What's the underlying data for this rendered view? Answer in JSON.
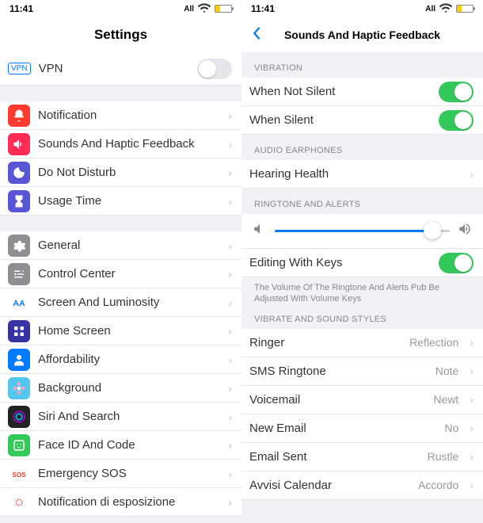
{
  "statusBar": {
    "time": "11:41",
    "carrier": "All"
  },
  "left": {
    "title": "Settings",
    "vpnLabel": "VPN",
    "vpnText": "VPN",
    "rows1": [
      {
        "label": "Notification",
        "icon": "#ff3b30",
        "svg": "bell"
      },
      {
        "label": "Sounds And Haptic Feedback",
        "icon": "#ff2d55",
        "svg": "speaker"
      },
      {
        "label": "Do Not Disturb",
        "icon": "#5856d6",
        "svg": "moon"
      },
      {
        "label": "Usage Time",
        "icon": "#5856d6",
        "svg": "hourglass"
      }
    ],
    "rows2": [
      {
        "label": "General",
        "icon": "#8e8e93",
        "svg": "gear"
      },
      {
        "label": "Control Center",
        "icon": "#8e8e93",
        "svg": "sliders"
      },
      {
        "label": "Screen And Luminosity",
        "icon": "#007aff",
        "svg": "aa"
      },
      {
        "label": "Home Screen",
        "icon": "#3634a3",
        "svg": "grid"
      },
      {
        "label": "Affordability",
        "icon": "#007aff",
        "svg": "person"
      },
      {
        "label": "Background",
        "icon": "#54c7ec",
        "svg": "flower"
      },
      {
        "label": "Siri And Search",
        "icon": "#222",
        "svg": "siri"
      },
      {
        "label": "Face ID And Code",
        "icon": "#34c759",
        "svg": "face"
      },
      {
        "label": "Emergency SOS",
        "icon": "#fff",
        "svg": "sos"
      },
      {
        "label": "Notification di esposizione",
        "icon": "#fff",
        "svg": "exposure"
      }
    ]
  },
  "right": {
    "title": "Sounds And Haptic Feedback",
    "sections": {
      "vibration": "VIBRATION",
      "audio": "AUDIO EARPHONES",
      "ringtone": "RINGTONE AND ALERTS",
      "note": "The Volume Of The Ringtone And Alerts Pub Be Adjusted With Volume Keys",
      "styles": "VIBRATE AND SOUND STYLES"
    },
    "whenNotSilent": "When Not Silent",
    "whenSilent": "When Silent",
    "hearing": "Hearing Health",
    "editKeys": "Editing With Keys",
    "styles": [
      {
        "label": "Ringer",
        "detail": "Reflection"
      },
      {
        "label": "SMS Ringtone",
        "detail": "Note"
      },
      {
        "label": "Voicemail",
        "detail": "Newt"
      },
      {
        "label": "New Email",
        "detail": "No"
      },
      {
        "label": "Email Sent",
        "detail": "Rustle"
      },
      {
        "label": "Avvisi Calendar",
        "detail": "Accordo"
      }
    ]
  }
}
